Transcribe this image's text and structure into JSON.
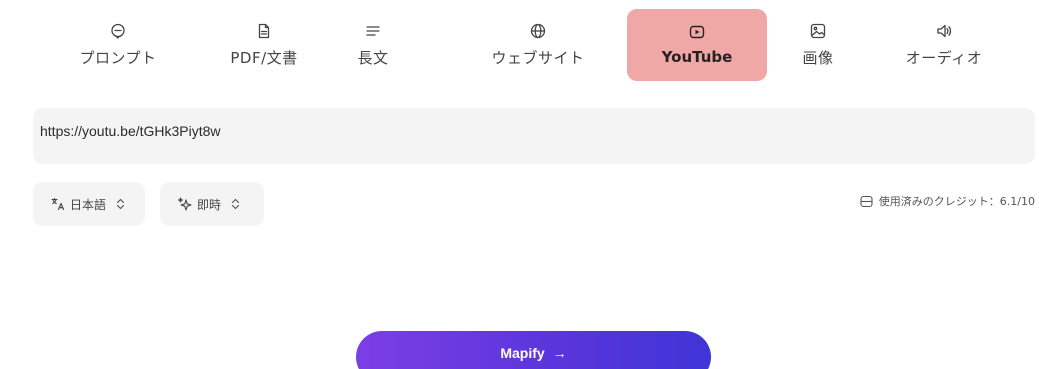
{
  "tabs": [
    {
      "id": "prompt",
      "label": "プロンプト",
      "icon": "message-circle-icon"
    },
    {
      "id": "pdf",
      "label": "PDF/文書",
      "icon": "document-icon"
    },
    {
      "id": "long",
      "label": "長文",
      "icon": "text-lines-icon"
    },
    {
      "id": "website",
      "label": "ウェブサイト",
      "icon": "globe-icon"
    },
    {
      "id": "youtube",
      "label": "YouTube",
      "icon": "play-icon",
      "active": true
    },
    {
      "id": "image",
      "label": "画像",
      "icon": "image-icon"
    },
    {
      "id": "audio",
      "label": "オーディオ",
      "icon": "speaker-icon"
    }
  ],
  "url_input": {
    "value": "https://youtu.be/tGHk3Piyt8w"
  },
  "language_select": {
    "value": "日本語",
    "icon": "translate-icon"
  },
  "mode_select": {
    "value": "即時",
    "icon": "sparkle-icon"
  },
  "credits": {
    "text": "使用済みのクレジット：6.1/10",
    "icon": "coin-stack-icon"
  },
  "submit": {
    "label": "Mapify",
    "arrow": "→"
  },
  "colors": {
    "active_tab_bg": "#f0a8a6",
    "input_bg": "#f4f4f5",
    "button_gradient_start": "#7b3fe4",
    "button_gradient_end": "#3f35d6"
  }
}
